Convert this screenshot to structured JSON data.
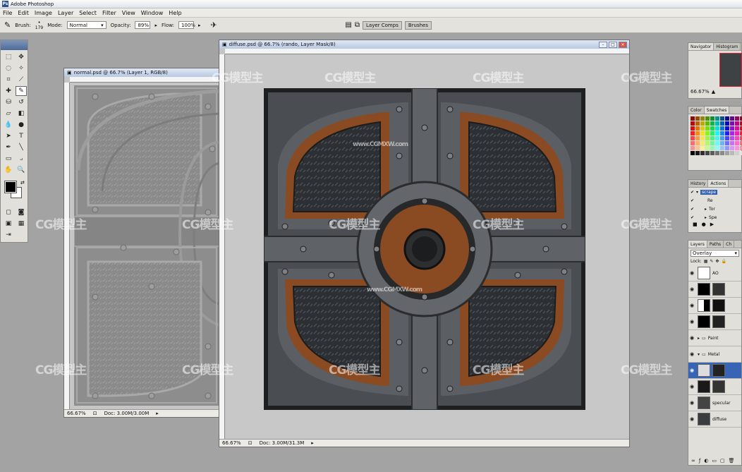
{
  "app": {
    "title": "Adobe Photoshop",
    "logo": "Ps"
  },
  "menu": [
    "File",
    "Edit",
    "Image",
    "Layer",
    "Select",
    "Filter",
    "View",
    "Window",
    "Help"
  ],
  "options": {
    "brush_label": "Brush:",
    "brush_size": "179",
    "mode_label": "Mode:",
    "mode_value": "Normal",
    "opacity_label": "Opacity:",
    "opacity_value": "89%",
    "flow_label": "Flow:",
    "flow_value": "100%",
    "tab1": "Layer Comps",
    "tab2": "Brushes"
  },
  "normal_doc": {
    "title": "normal.psd @ 66.7% (Layer 1, RGB/8)",
    "zoom": "66.67%",
    "doc": "Doc: 3.00M/3.00M"
  },
  "diffuse_doc": {
    "title": "diffuse.psd @ 66.7% (rando, Layer Mask/8)",
    "zoom": "66.67%",
    "doc": "Doc: 3.00M/31.3M"
  },
  "navigator": {
    "tab1": "Navigator",
    "tab2": "Histogram",
    "zoom": "66.67%"
  },
  "color_panel": {
    "tab1": "Color",
    "tab2": "Swatches"
  },
  "history_panel": {
    "tab1": "History",
    "tab2": "Actions",
    "items": [
      "scrape",
      "Re",
      "Tor",
      "Spe"
    ]
  },
  "layers_panel": {
    "tab1": "Layers",
    "tab2": "Paths",
    "tab3": "Ch",
    "blend": "Overlay",
    "lock_label": "Lock:",
    "rows": [
      "AO",
      "",
      "",
      "",
      "Paint",
      "Metal",
      "",
      "",
      "specular",
      "diffuse"
    ]
  },
  "watermarks": [
    "CG模型主",
    "www.CGMXW.com"
  ],
  "colors": {
    "rust": "#8a4a22",
    "metal": "#5e6265",
    "dark": "#1e2022",
    "canvas_bg": "#c8c8c8",
    "normal_gray": "#8d8d8d"
  }
}
